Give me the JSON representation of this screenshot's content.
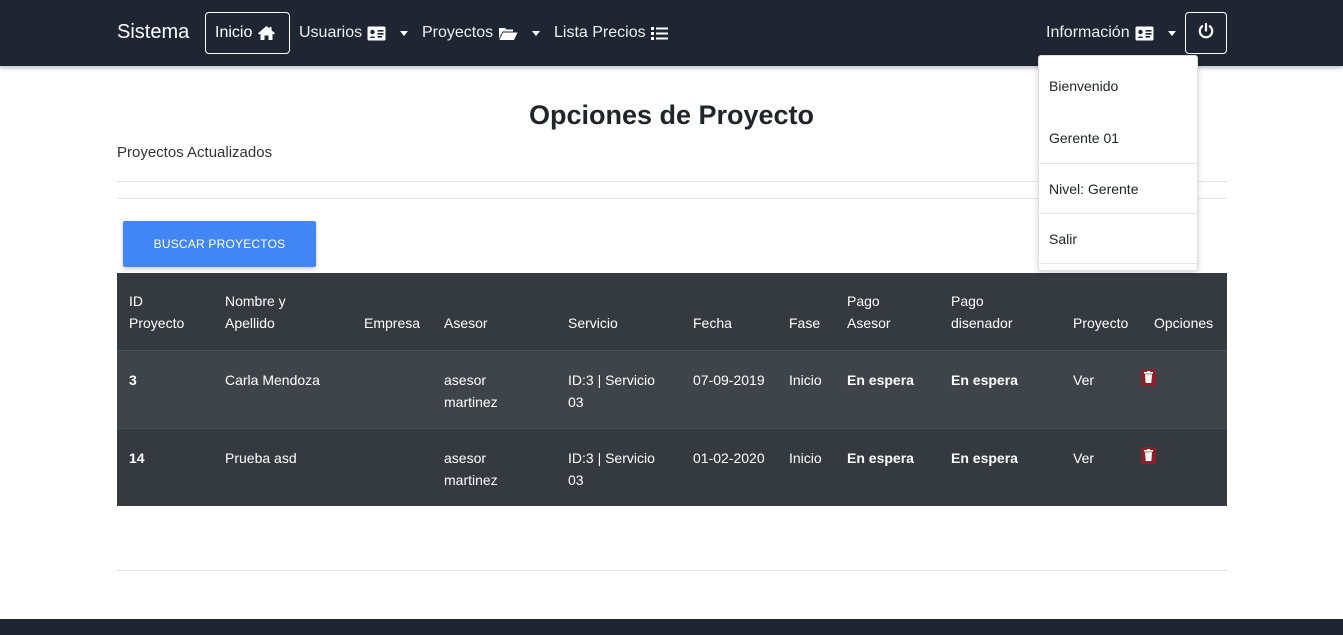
{
  "navbar": {
    "brand": "Sistema",
    "items": [
      {
        "label": "Inicio",
        "icon": "home-icon"
      },
      {
        "label": "Usuarios",
        "icon": "id-card-icon"
      },
      {
        "label": "Proyectos",
        "icon": "folder-open-icon"
      },
      {
        "label": "Lista Precios",
        "icon": "list-icon"
      }
    ],
    "info_label": "Información",
    "power_icon": "power-icon"
  },
  "dropdown": {
    "items": [
      "Bienvenido",
      "Gerente 01",
      "Nivel: Gerente",
      "Salir"
    ]
  },
  "main": {
    "title": "Opciones de Proyecto",
    "subtitle": "Proyectos Actualizados",
    "search_button": "BUSCAR PROYECTOS"
  },
  "table": {
    "headers": {
      "id": [
        "ID",
        "Proyecto"
      ],
      "nombre": [
        "Nombre y",
        "Apellido"
      ],
      "empresa": "Empresa",
      "asesor": "Asesor",
      "servicio": "Servicio",
      "fecha": "Fecha",
      "fase": "Fase",
      "pago_asesor": [
        "Pago",
        "Asesor"
      ],
      "pago_disenador": [
        "Pago",
        "disenador"
      ],
      "proyecto": "Proyecto",
      "opciones": "Opciones"
    },
    "rows": [
      {
        "id": "3",
        "nombre": "Carla Mendoza",
        "empresa": "",
        "asesor": [
          "asesor",
          "martinez"
        ],
        "servicio": [
          "ID:3 | Servicio",
          "03"
        ],
        "fecha": "07-09-2019",
        "fase": "Inicio",
        "pago_asesor": "En espera",
        "pago_disenador": "En espera",
        "proyecto": "Ver",
        "delete_icon": "trash-icon"
      },
      {
        "id": "14",
        "nombre": "Prueba asd",
        "empresa": "",
        "asesor": [
          "asesor",
          "martinez"
        ],
        "servicio": [
          "ID:3 | Servicio",
          "03"
        ],
        "fecha": "01-02-2020",
        "fase": "Inicio",
        "pago_asesor": "En espera",
        "pago_disenador": "En espera",
        "proyecto": "Ver",
        "delete_icon": "trash-icon"
      }
    ]
  },
  "colors": {
    "navbar_bg": "#1f2533",
    "primary_button": "#4285f4",
    "table_bg": "#343a40",
    "delete_icon": "#b02a37"
  }
}
